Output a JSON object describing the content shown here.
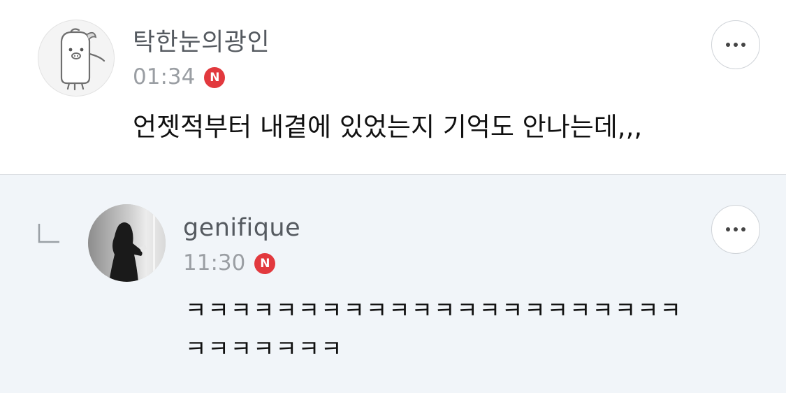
{
  "comments": [
    {
      "author": "탁한눈의광인",
      "time": "01:34",
      "badge": "N",
      "text": "언젯적부터 내곁에 있었는지 기억도 안나는데,,,",
      "avatar_icon": "mascot-avatar-icon"
    },
    {
      "author": "genifique",
      "time": "11:30",
      "badge": "N",
      "text_lines": [
        "ㅋㅋㅋㅋㅋㅋㅋㅋㅋㅋㅋㅋㅋㅋㅋㅋㅋㅋㅋㅋㅋㅋ",
        "ㅋㅋㅋㅋㅋㅋㅋ"
      ],
      "avatar_icon": "photo-avatar-icon",
      "is_reply": true
    }
  ],
  "icons": {
    "more": "more-options-icon",
    "reply": "reply-arrow-icon"
  },
  "colors": {
    "badge": "#e2393e",
    "reply_background": "#f1f5f9",
    "author_text": "#555a60",
    "time_text": "#9a9ea3"
  }
}
